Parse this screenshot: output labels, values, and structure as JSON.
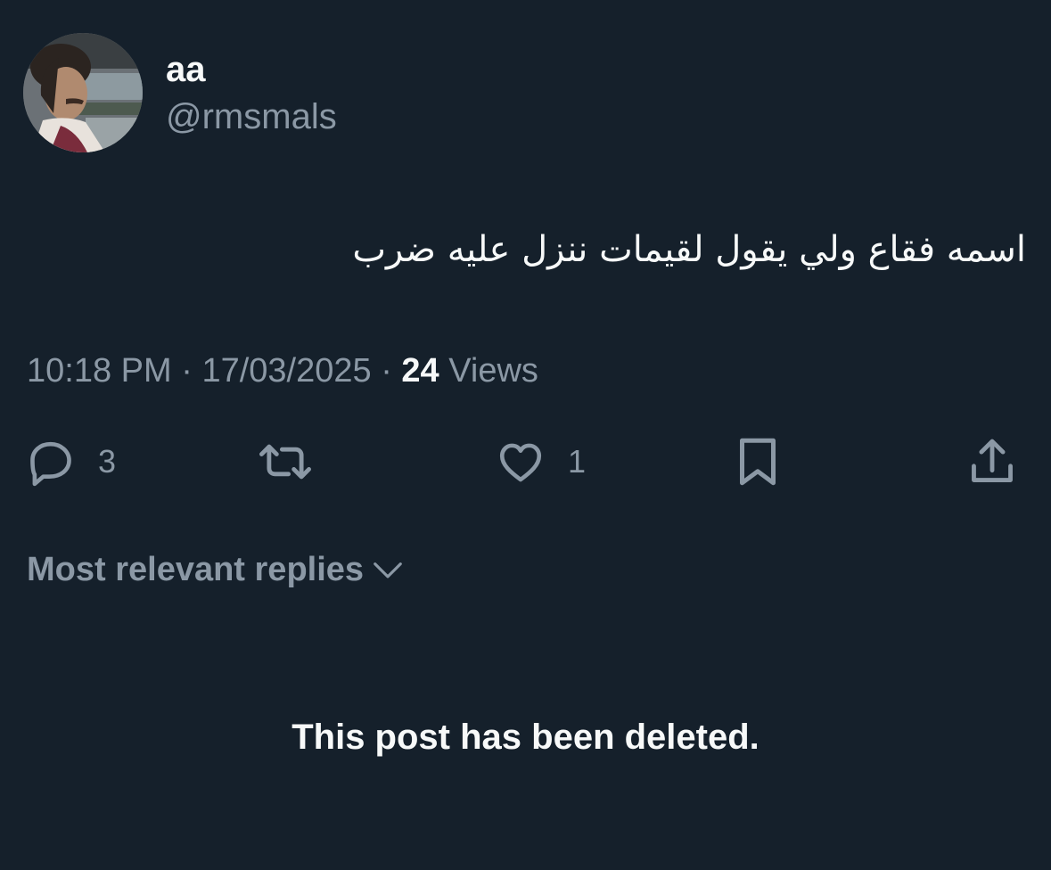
{
  "author": {
    "display_name": "aa",
    "handle": "@rmsmals"
  },
  "post": {
    "text": "اسمه فقاع ولي يقول لقيمات ننزل عليه ضرب",
    "time": "10:18 PM",
    "separator": "·",
    "date": "17/03/2025",
    "views_count": "24",
    "views_label": "Views"
  },
  "actions": {
    "reply_count": "3",
    "like_count": "1",
    "reply_icon": "reply-icon",
    "repost_icon": "repost-icon",
    "like_icon": "heart-icon",
    "bookmark_icon": "bookmark-icon",
    "share_icon": "share-icon"
  },
  "replies": {
    "sort_label": "Most relevant replies",
    "deleted_notice": "This post has been deleted."
  },
  "colors": {
    "background": "#15202b",
    "primary_text": "#f7f9f9",
    "secondary_text": "#8b98a5"
  }
}
